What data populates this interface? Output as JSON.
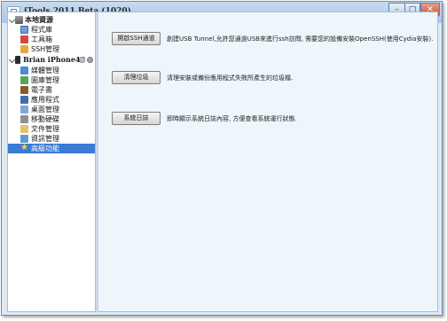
{
  "window": {
    "title": "iTools 2011 Beta (1020)"
  },
  "window_controls": {
    "minimize": "–",
    "maximize": "□",
    "close": "✕"
  },
  "sidebar": {
    "local_group": {
      "label": "本地資源"
    },
    "local_items": [
      {
        "label": "程式庫",
        "icon": "app-library-icon"
      },
      {
        "label": "工具箱",
        "icon": "toolbox-icon"
      },
      {
        "label": "SSH管理",
        "icon": "ssh-manager-icon"
      }
    ],
    "device_group": {
      "label": "Brian iPhone4S"
    },
    "device_items": [
      {
        "label": "媒體管理",
        "icon": "media-icon"
      },
      {
        "label": "圖庫管理",
        "icon": "photos-icon"
      },
      {
        "label": "電子書",
        "icon": "ebook-icon"
      },
      {
        "label": "應用程式",
        "icon": "apps-icon"
      },
      {
        "label": "桌面管理",
        "icon": "desktop-icon"
      },
      {
        "label": "移動硬碟",
        "icon": "mobile-disk-icon"
      },
      {
        "label": "文件管理",
        "icon": "file-icon"
      },
      {
        "label": "資訊管理",
        "icon": "info-icon"
      },
      {
        "label": "高級功能",
        "icon": "star-icon",
        "selected": true
      }
    ]
  },
  "main": {
    "actions": [
      {
        "button": "開啟SSH通道",
        "description": "創建USB Tunnel,允許您通過USB來進行ssh訪問, 需要您的設備安裝OpenSSH(使用Cydia安裝)."
      },
      {
        "button": "清理垃圾",
        "description": "清理安裝或備份應用程式失敗所產生的垃圾檔."
      },
      {
        "button": "系統日誌",
        "description": "即時顯示系統日誌內容, 方便查看系統運行狀態."
      }
    ]
  },
  "colors": {
    "selection": "#3a7bd5",
    "main_bg": "#eef6fb",
    "title_bar": "#b8d0ea",
    "close_button": "#c94d33"
  }
}
